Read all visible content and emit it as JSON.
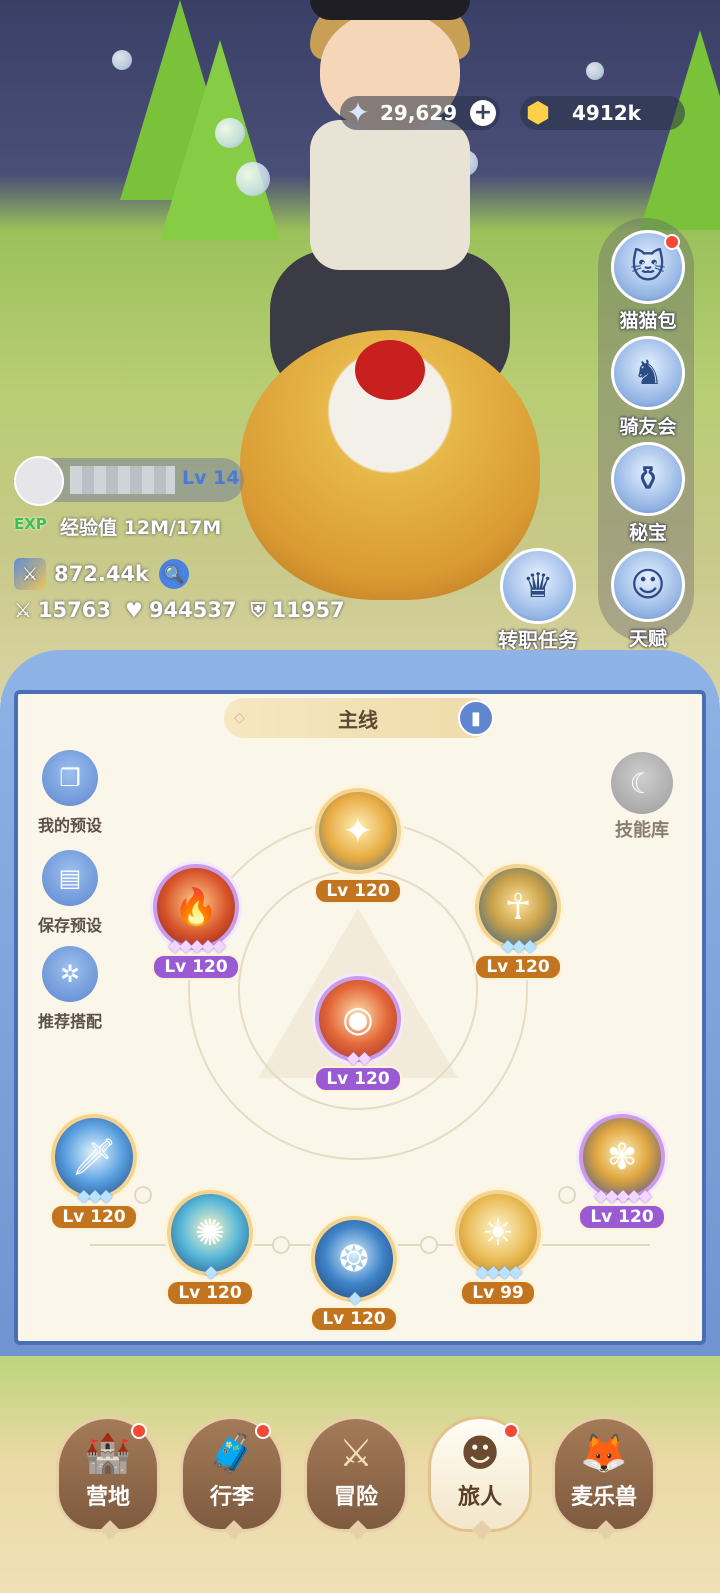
{
  "currency": {
    "stars": "29,629",
    "stars_icon": "star-crystal-icon",
    "gold": "4912k",
    "gold_icon": "gold-coin-icon"
  },
  "side_menu": [
    {
      "label": "猫猫包",
      "icon": "cat-bag-icon",
      "badge": true
    },
    {
      "label": "骑友会",
      "icon": "horse-icon",
      "badge": false
    },
    {
      "label": "秘宝",
      "icon": "treasure-icon",
      "badge": false
    },
    {
      "label": "天赋",
      "icon": "talent-head-icon",
      "badge": false
    }
  ],
  "job_button": {
    "label": "转职任务",
    "icon": "crown-icon"
  },
  "player": {
    "level": "Lv 14",
    "exp_label": "经验值",
    "exp_value": "12M/17M",
    "exp_icon_text": "EXP",
    "power": "872.44k",
    "attack": "15763",
    "hp": "944537",
    "defense": "11957"
  },
  "panel": {
    "tab_title": "主线",
    "left_buttons": [
      "我的预设",
      "保存预设",
      "推荐搭配"
    ],
    "skill_library": "技能库",
    "skills": [
      {
        "level": "Lv 120",
        "stars": "",
        "style": "gold"
      },
      {
        "level": "Lv 120",
        "stars": "◆◆◆◆◆",
        "style": "purple"
      },
      {
        "level": "Lv 120",
        "stars": "◆◆◆",
        "style": "gold"
      },
      {
        "level": "Lv 120",
        "stars": "◆◆",
        "style": "purple"
      },
      {
        "level": "Lv 120",
        "stars": "◆◆◆",
        "style": "gold"
      },
      {
        "level": "Lv 120",
        "stars": "◆",
        "style": "gold"
      },
      {
        "level": "Lv 120",
        "stars": "◆",
        "style": "gold"
      },
      {
        "level": "Lv 99",
        "stars": "◆◆◆◆",
        "style": "gold"
      },
      {
        "level": "Lv 120",
        "stars": "◆◆◆◆◆",
        "style": "purple"
      }
    ]
  },
  "bottom_nav": [
    {
      "label": "营地",
      "icon": "castle-icon",
      "badge": true,
      "active": false
    },
    {
      "label": "行李",
      "icon": "chest-icon",
      "badge": true,
      "active": false
    },
    {
      "label": "冒险",
      "icon": "crossed-swords-icon",
      "badge": false,
      "active": false
    },
    {
      "label": "旅人",
      "icon": "traveler-avatar-icon",
      "badge": true,
      "active": true
    },
    {
      "label": "麦乐兽",
      "icon": "fox-icon",
      "badge": false,
      "active": false
    }
  ],
  "colors": {
    "accent_blue": "#4b6fb5",
    "badge_red": "#f44a35",
    "gold_level": "#c2741f",
    "purple_level": "#9a5ad3"
  }
}
